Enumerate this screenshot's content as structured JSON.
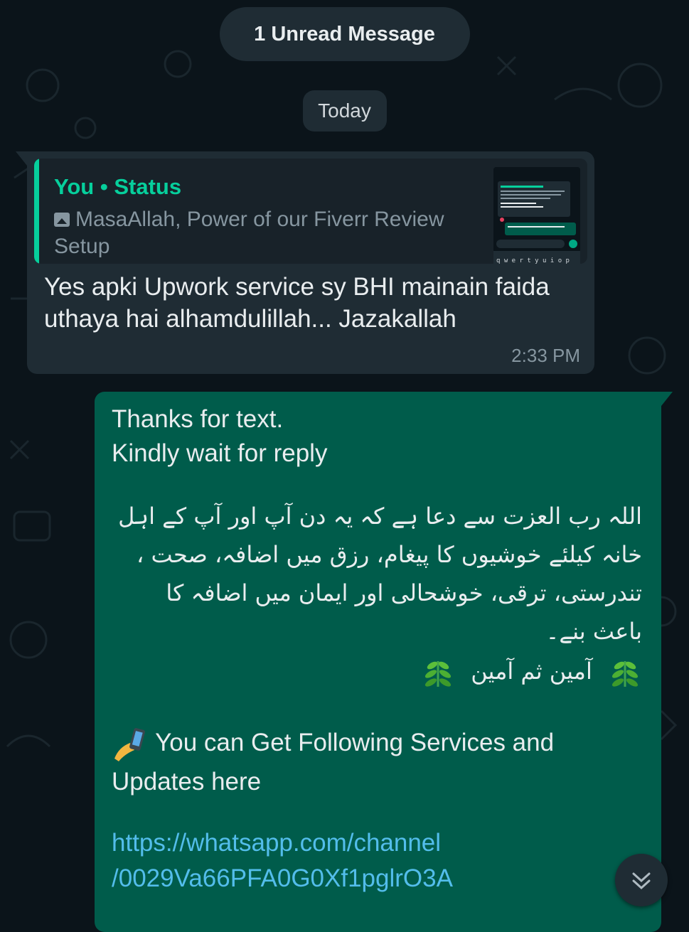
{
  "chat": {
    "unread_label": "1 Unread Message",
    "date_label": "Today"
  },
  "incoming": {
    "quote_sender": "You • Status",
    "quote_text": "MasaAllah, Power of our Fiverr Review Setup",
    "message": "Yes apki Upwork service sy BHI mainain faida uthaya hai alhamdulillah... Jazakallah",
    "time": "2:33 PM"
  },
  "outgoing": {
    "line1": "Thanks for text.",
    "line2": "Kindly wait for reply",
    "urdu_paragraph": "اللہ رب العزت سے دعا ہے کہ یہ دن آپ اور آپ کے اہل خانہ کیلئے خوشیوں کا پیغام، رزق میں اضافہ، صحت ، تندرستی، ترقی، خوشحالی اور ایمان میں اضافہ کا باعث بنے۔",
    "urdu_prayer": "آمین ثم آمین",
    "services_text": "You can Get Following Services and Updates here",
    "link_part1": "https://whatsapp.com/channel",
    "link_part2": "/0029Va66PFA0G0Xf1pglrO3A"
  },
  "icons": {
    "image": "image-icon",
    "herb": "herb-icon",
    "phone": "mobile-phone-icon",
    "scroll_down": "double-chevron-down-icon"
  },
  "colors": {
    "background": "#0b141a",
    "incoming_bubble": "#1f2c34",
    "outgoing_bubble": "#005c4b",
    "accent": "#06cf9c",
    "link": "#53bdeb"
  }
}
